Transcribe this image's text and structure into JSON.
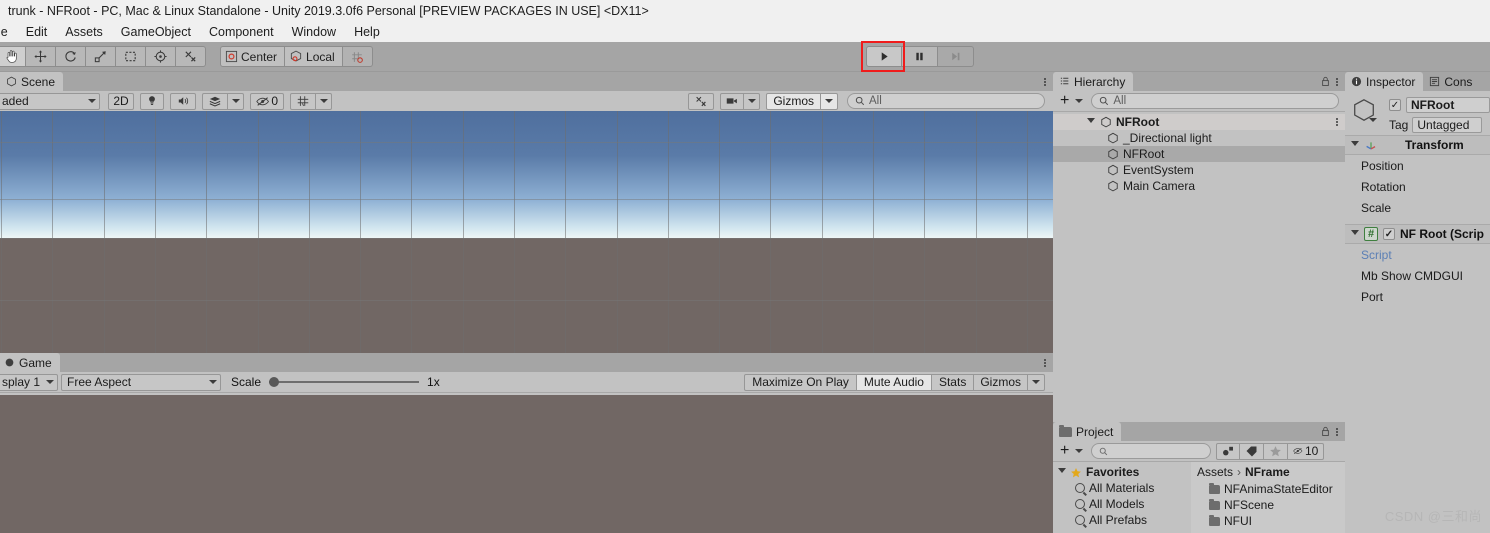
{
  "window": {
    "title": "trunk - NFRoot - PC, Mac & Linux Standalone - Unity 2019.3.0f6 Personal [PREVIEW PACKAGES IN USE] <DX11>"
  },
  "menu": {
    "items": [
      "le",
      "Edit",
      "Assets",
      "GameObject",
      "Component",
      "Window",
      "Help"
    ]
  },
  "toolbar": {
    "tools": [
      {
        "name": "hand-tool",
        "icon": "hand",
        "active": true
      },
      {
        "name": "move-tool",
        "icon": "move",
        "active": false
      },
      {
        "name": "rotate-tool",
        "icon": "rotate",
        "active": false
      },
      {
        "name": "scale-tool",
        "icon": "scale",
        "active": false
      },
      {
        "name": "rect-tool",
        "icon": "rect",
        "active": false
      },
      {
        "name": "transform-tool",
        "icon": "transform",
        "active": false
      },
      {
        "name": "custom-editor-tool",
        "icon": "tools",
        "active": false
      }
    ],
    "pivot_label": "Center",
    "rotation_label": "Local",
    "snap_label": "grid-snapping",
    "play_label": "play-button",
    "pause_label": "pause-button",
    "step_label": "step-button",
    "collab_label": "",
    "highlight_color": "#f01c1c"
  },
  "scene": {
    "tab_label": "Scene",
    "shading_mode": "aded",
    "btn_2d": "2D",
    "lighting_icon": "lightbulb-icon",
    "audio_icon": "audio-icon",
    "fx_icon": "effects-icon",
    "hidden_count": "0",
    "grid_icon": "grid-icon",
    "tools_icon": "scene-tools-icon",
    "camera_icon": "scene-camera-icon",
    "gizmos_label": "Gizmos",
    "search_placeholder": "All",
    "sky_top_color": "#4f6f9e",
    "sky_horizon_color": "#eef6f6",
    "ground_color": "#716764"
  },
  "game": {
    "tab_label": "Game",
    "display_label": "splay 1",
    "aspect_label": "Free Aspect",
    "scale_label": "Scale",
    "scale_value": "1x",
    "maximize_label": "Maximize On Play",
    "mute_label": "Mute Audio",
    "stats_label": "Stats",
    "gizmos_label": "Gizmos",
    "background_color": "#716764"
  },
  "hierarchy": {
    "tab_label": "Hierarchy",
    "create_label": "+",
    "search_placeholder": "All",
    "lock_icon": "lock-icon",
    "items": [
      {
        "label": "NFRoot",
        "type": "scene",
        "depth": 0,
        "expanded": true,
        "selected": false
      },
      {
        "label": "_Directional light",
        "type": "gameobject",
        "depth": 1,
        "expanded": false,
        "selected": false
      },
      {
        "label": "NFRoot",
        "type": "gameobject",
        "depth": 1,
        "expanded": false,
        "selected": true
      },
      {
        "label": "EventSystem",
        "type": "gameobject",
        "depth": 1,
        "expanded": false,
        "selected": false
      },
      {
        "label": "Main Camera",
        "type": "gameobject",
        "depth": 1,
        "expanded": false,
        "selected": false
      }
    ]
  },
  "inspector": {
    "tab_label": "Inspector",
    "console_tab_label": "Cons",
    "object_name": "NFRoot",
    "enabled": true,
    "tag_label": "Tag",
    "tag_value": "Untagged",
    "components": [
      {
        "title": "Transform",
        "icon": "transform-icon",
        "expanded": true,
        "fields": [
          {
            "label": "Position",
            "kind": "vector"
          },
          {
            "label": "Rotation",
            "kind": "vector"
          },
          {
            "label": "Scale",
            "kind": "vector"
          }
        ]
      },
      {
        "title": "NF Root (Scrip",
        "icon": "script-icon",
        "expanded": true,
        "enabled": true,
        "fields": [
          {
            "label": "Script",
            "kind": "link"
          },
          {
            "label": "Mb Show CMDGUI",
            "kind": "bool"
          },
          {
            "label": "Port",
            "kind": "number"
          }
        ]
      }
    ]
  },
  "project": {
    "tab_label": "Project",
    "create_label": "+",
    "search_placeholder": "",
    "lock_icon": "lock-icon",
    "filter_type_icon": "filter-by-type-icon",
    "filter_label_icon": "filter-by-label-icon",
    "favorite_icon": "star-icon",
    "hidden_count": "10",
    "favorites_label": "Favorites",
    "favorites": [
      "All Materials",
      "All Models",
      "All Prefabs"
    ],
    "breadcrumb": [
      "Assets",
      "NFrame"
    ],
    "folders": [
      "NFAnimaStateEditor",
      "NFScene",
      "NFUI"
    ]
  },
  "watermark": "CSDN @三和尚"
}
